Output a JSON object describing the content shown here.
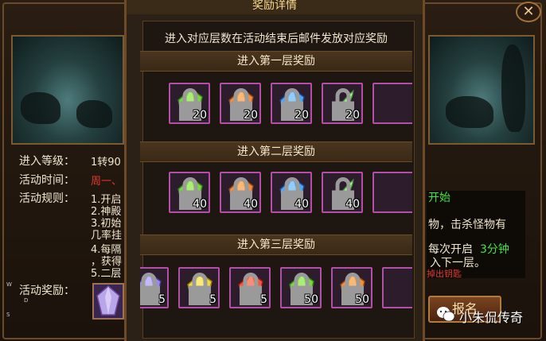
{
  "dialog": {
    "title": "奖励详情",
    "description": "进入对应层数在活动结束后邮件发放对应奖励"
  },
  "tiers": [
    {
      "label": "进入第一层奖励",
      "items": [
        {
          "gem": "green-crystal",
          "count": "20"
        },
        {
          "gem": "orange-crystal",
          "count": "20"
        },
        {
          "gem": "blue-crystal",
          "count": "20"
        },
        {
          "gem": "green-feather",
          "count": "20"
        }
      ]
    },
    {
      "label": "进入第二层奖励",
      "items": [
        {
          "gem": "green-crystal",
          "count": "40"
        },
        {
          "gem": "orange-crystal",
          "count": "40"
        },
        {
          "gem": "blue-crystal",
          "count": "40"
        },
        {
          "gem": "green-feather",
          "count": "40"
        }
      ]
    },
    {
      "label": "进入第三层奖励",
      "items": [
        {
          "gem": "purple-crystal",
          "count": "5"
        },
        {
          "gem": "yellow-crystal",
          "count": "5"
        },
        {
          "gem": "red-crystal",
          "count": "5"
        },
        {
          "gem": "green-crystal",
          "count": "50"
        },
        {
          "gem": "orange-crystal",
          "count": "50"
        }
      ]
    }
  ],
  "background": {
    "level_label": "进入等级：",
    "level_value": "1转90",
    "time_label": "活动时间：",
    "time_value": "周一、",
    "rules_label": "活动规则：",
    "rules_lines": [
      "1.开启",
      "2.神殿",
      "3.初始",
      "几率挂",
      "4.每隔",
      "，获得",
      "5.二层"
    ],
    "reward_label": "活动奖励：",
    "right_lines": [
      "开始",
      "物，击杀怪物有",
      "每次开启",
      "入下一层。",
      "掉出钥匙"
    ],
    "right_green": "3分钟",
    "signup_label": "报名",
    "compass": [
      "W",
      "D",
      "S"
    ]
  },
  "watermark": "小朱侃传奇",
  "colors": {
    "accent_red": "#e03a2a",
    "accent_green": "#3ee63a",
    "slot_border": "#b24fa6",
    "title_gold": "#f6d890"
  }
}
